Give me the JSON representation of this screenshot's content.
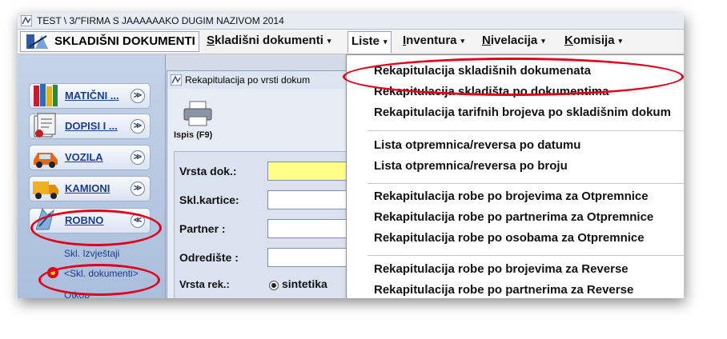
{
  "window": {
    "title": "TEST \\ 3/\"FIRMA S JAAAAAAKO DUGIM NAZIVOM  2014"
  },
  "menubar": {
    "brand": "SKLADIŠNI DOKUMENTI",
    "items": [
      {
        "label": "Skladišni dokumenti",
        "underline": "S",
        "rest": "kladišni dokumenti"
      },
      {
        "label": "Liste",
        "underline": "",
        "rest": "Liste"
      },
      {
        "label": "Inventura",
        "underline": "I",
        "rest": "nventura"
      },
      {
        "label": "Nivelacija",
        "underline": "N",
        "rest": "ivelacija"
      },
      {
        "label": "Komisija",
        "underline": "K",
        "rest": "omisija"
      }
    ],
    "arrow": "▾"
  },
  "sidebar": {
    "items": [
      {
        "label": "MATIČNI ...",
        "chevron": "≫"
      },
      {
        "label": "DOPISI I ...",
        "chevron": "≫"
      },
      {
        "label": "VOZILA",
        "chevron": "≫"
      },
      {
        "label": "KAMIONI",
        "chevron": "≫"
      },
      {
        "label": "ROBNO",
        "chevron": "≪"
      }
    ],
    "sublinks": [
      "Skl. Izvještaji",
      "<Skl. dokumenti>",
      "Otkop"
    ]
  },
  "child_window": {
    "title": "Rekapitulacija po vrsti dokum",
    "print_label": "Ispis (F9)",
    "fields": [
      {
        "label": "Vrsta dok.:"
      },
      {
        "label": "Skl.kartice:"
      },
      {
        "label": "Partner :"
      },
      {
        "label": "Odredište :"
      }
    ],
    "rek_label": "Vrsta rek.:",
    "rek_option": "sintetika"
  },
  "dropdown": {
    "items": [
      "Rekapitulacija skladišnih dokumenata",
      "Rekapitulacija skladišta po dokumentima",
      "Rekapitulacija tarifnih brojeva po skladišnim dokum",
      "Lista otpremnica/reversa po datumu",
      "Lista otpremnica/reversa po broju",
      "Rekapitulacija robe po brojevima za Otpremnice",
      "Rekapitulacija robe po partnerima za Otpremnice",
      "Rekapitulacija robe po osobama za Otpremnice",
      "Rekapitulacija robe po brojevima za Reverse",
      "Rekapitulacija robe po partnerima za Reverse"
    ]
  },
  "colors": {
    "annotation_ring": "#e0001b",
    "highlight_field": "#ffff88"
  }
}
